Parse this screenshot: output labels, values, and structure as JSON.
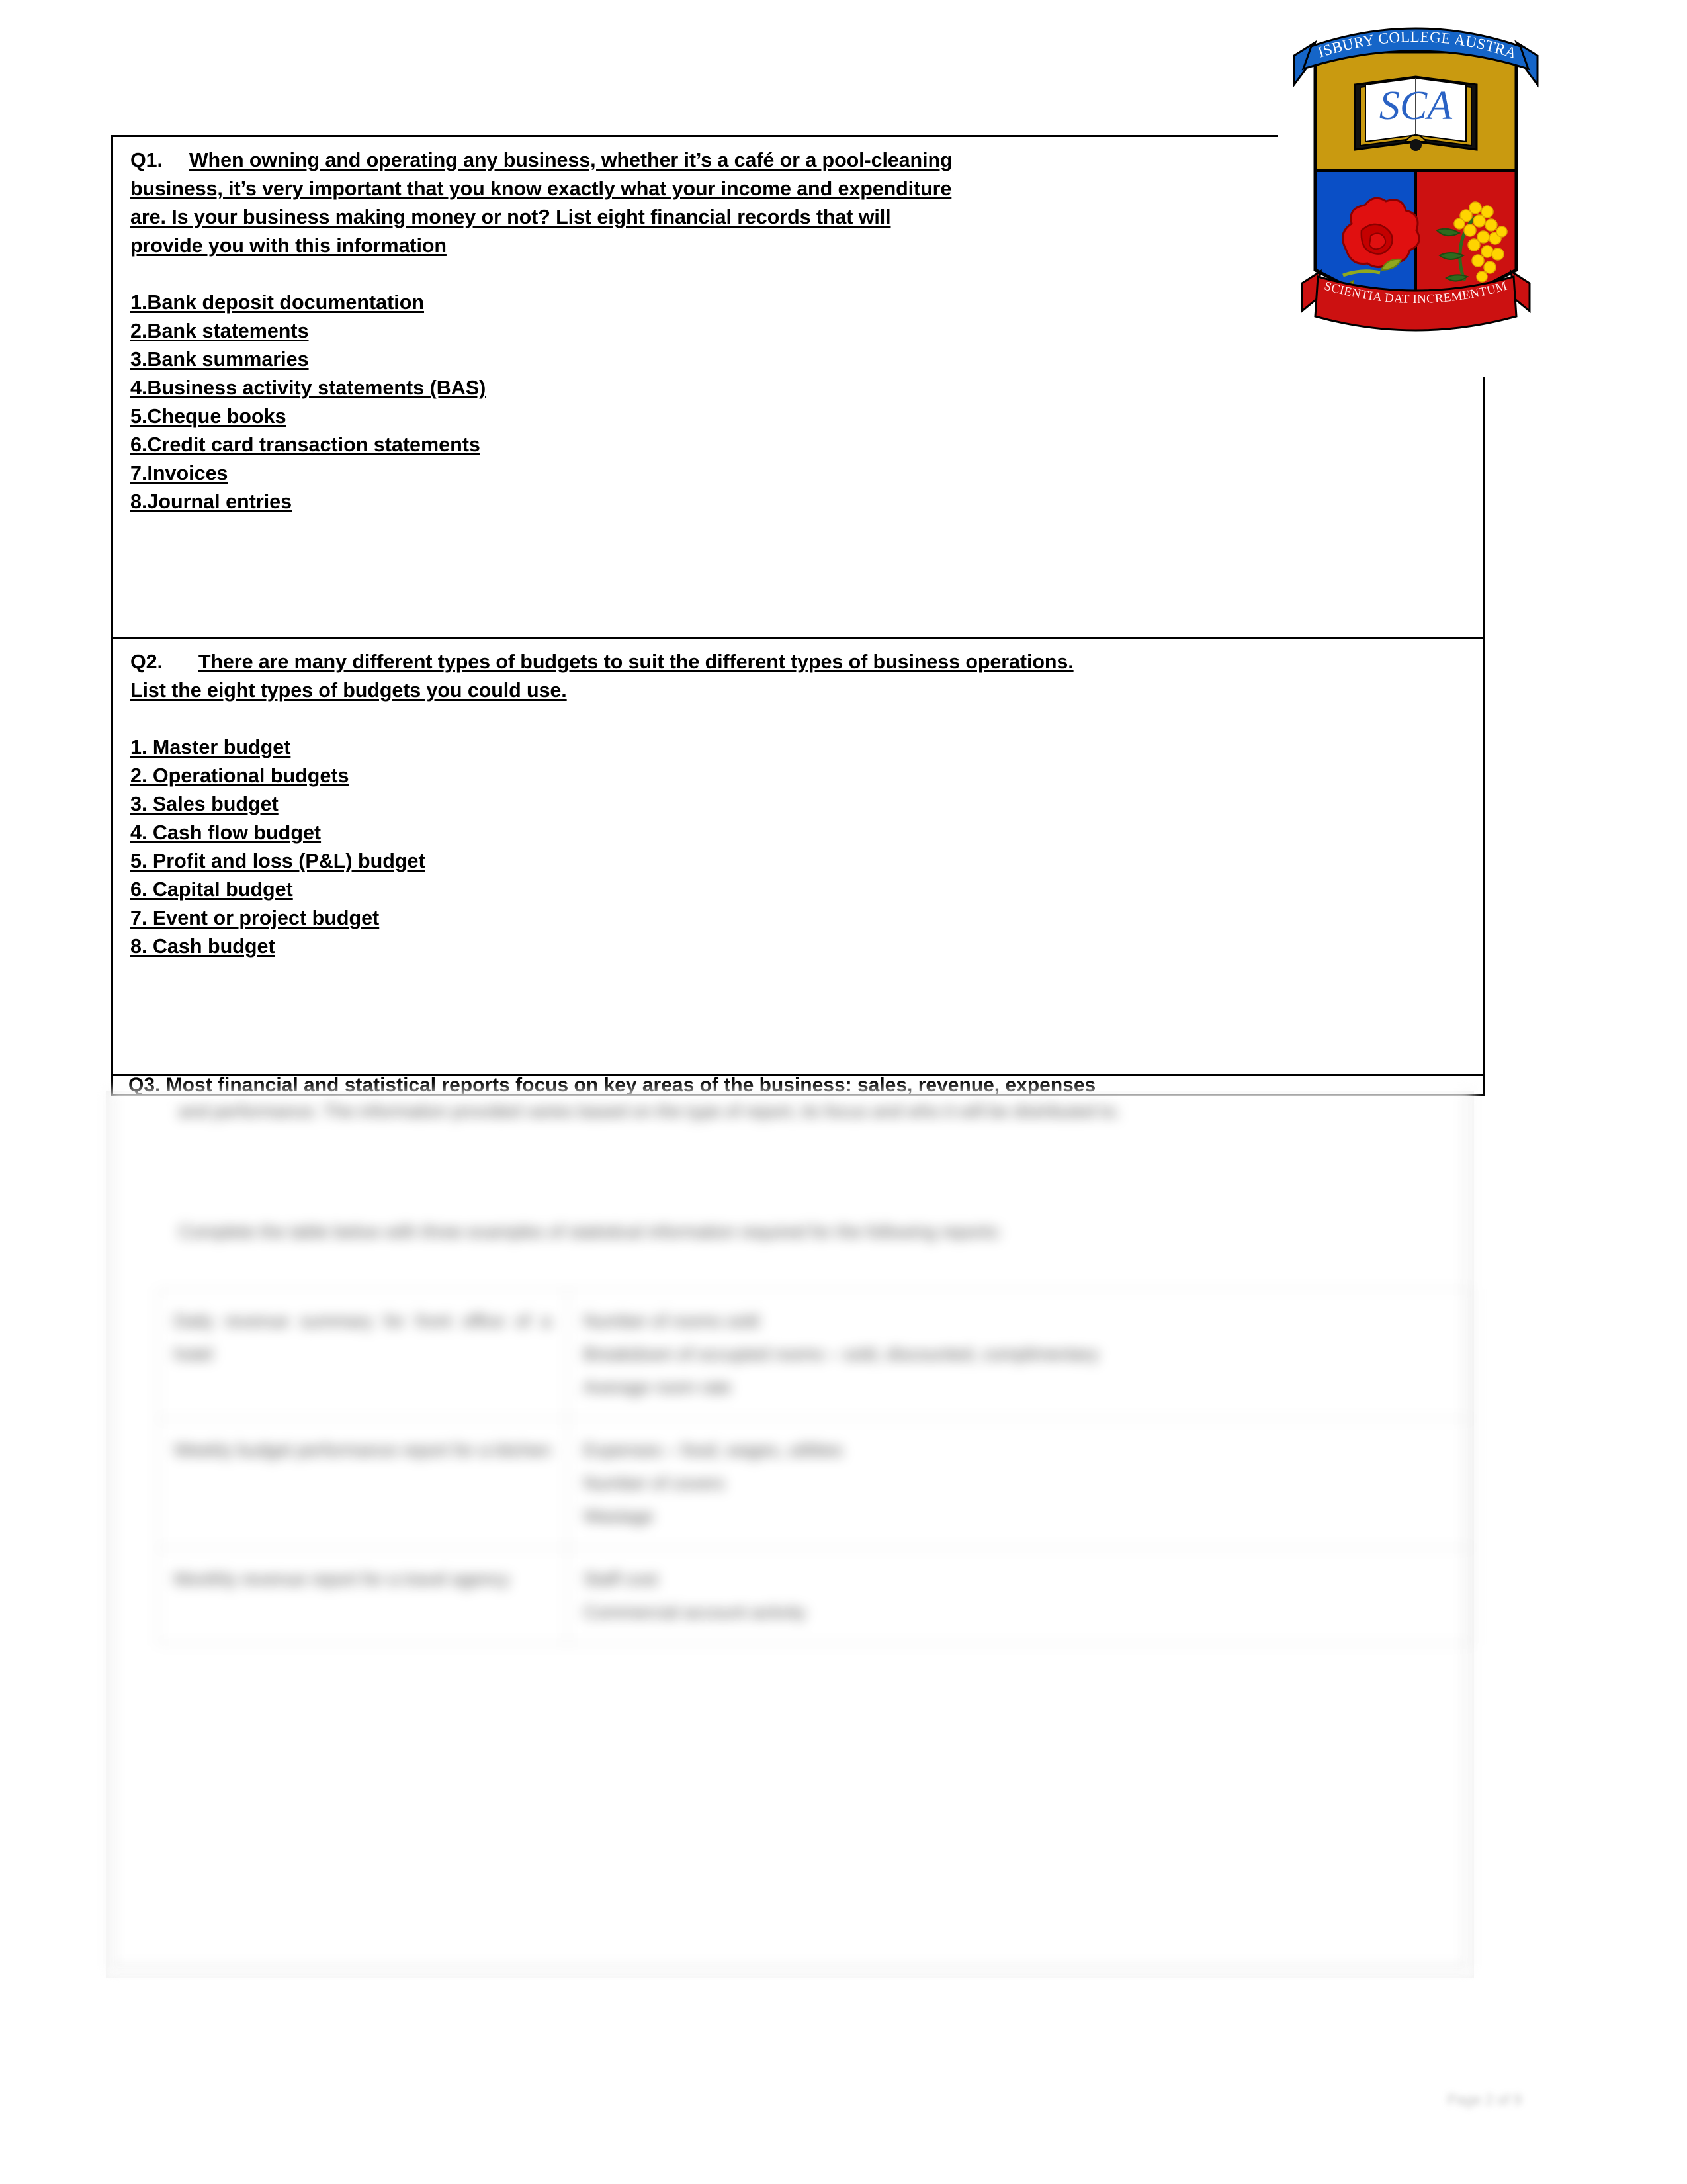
{
  "institution": {
    "name": "SALISBURY COLLEGE AUSTRALIA",
    "abbreviation": "SCA",
    "motto": "SCIENTIA DAT INCREMENTUM",
    "colors": {
      "banner_blue": "#1565C8",
      "shield_gold": "#C99A10",
      "shield_blue": "#0A4FC6",
      "shield_red": "#CC1111",
      "ribbon_red": "#CC1111",
      "text_blue": "#2A62C4"
    }
  },
  "questions": [
    {
      "id": "q1",
      "number": "Q1.",
      "text": "When owning and operating any business, whether it’s a café or a pool-cleaning business, it’s very important that you know exactly what your income and expenditure are. Is your business making money or not? List eight financial records that will provide you with this information",
      "lines": [
        "When owning and operating any business, whether it’s a café or a pool-cleaning",
        "business, it’s very important that you know exactly what your income and expenditure",
        "are. Is your business making money or not? List eight financial records that will",
        "provide you with this information"
      ],
      "answers": [
        "1.Bank deposit documentation",
        "2.Bank statements",
        "3.Bank summaries",
        "4.Business activity statements (BAS)",
        "5.Cheque books",
        "6.Credit card transaction statements",
        "7.Invoices",
        "8.Journal entries"
      ]
    },
    {
      "id": "q2",
      "number": "Q2.",
      "text": "There are many different types of budgets to suit the different types of business operations. List the eight types of budgets you could use.",
      "lines": [
        "There are many different types of budgets to suit the different types of business operations.",
        "List the eight types of budgets you could use."
      ],
      "answers": [
        "1. Master budget",
        "2. Operational budgets",
        "3. Sales budget",
        "4. Cash flow budget",
        "5. Profit and loss (P&L) budget",
        "6. Capital budget",
        "7. Event or project budget",
        "8. Cash budget"
      ]
    },
    {
      "id": "q3",
      "number": "Q3.",
      "visible_line": "Q3. Most financial and statistical reports focus on key areas of the business: sales, revenue, expenses",
      "blurred_paragraph_1": "and performance. The information provided varies based on the type of report, its focus and who it will be distributed to.",
      "blurred_paragraph_2": "Complete the table below with three examples of statistical information required for the following reports:",
      "table": {
        "rows": [
          {
            "report": "Daily revenue summary for front office of a hotel",
            "items": [
              "Number of rooms sold",
              "Breakdown of occupied rooms – sold, discounted, complimentary",
              "Average room rate"
            ]
          },
          {
            "report": "Weekly budget performance report for a kitchen",
            "items": [
              "Expenses – food, wages, utilities",
              "Number of covers",
              "Wastage"
            ]
          },
          {
            "report": "Monthly revenue report for a travel agency",
            "items": [
              "Staff cost",
              "Commercial account activity"
            ]
          }
        ]
      }
    }
  ],
  "footer": {
    "page_label": "Page 2 of 9"
  }
}
